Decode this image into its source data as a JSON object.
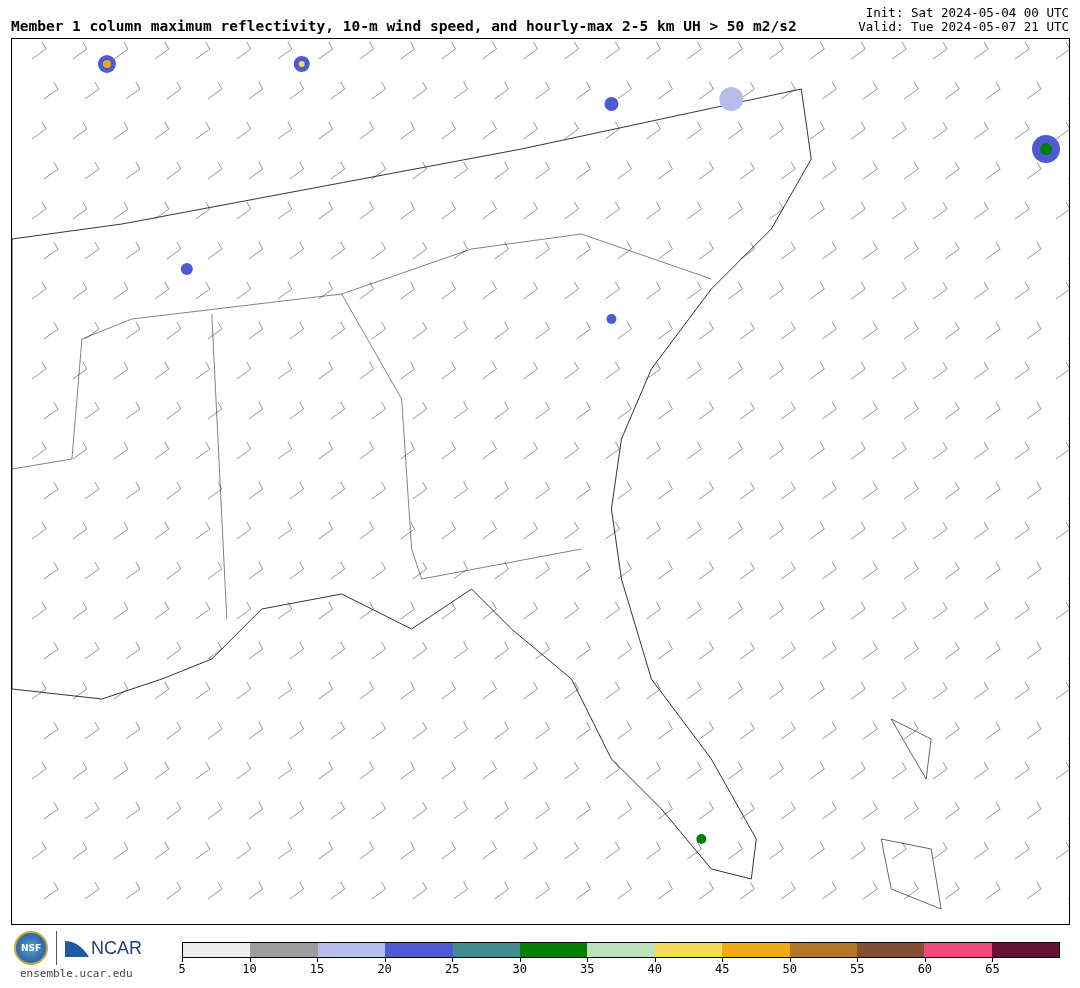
{
  "title": "Member 1 column maximum reflectivity, 10-m wind speed, and hourly-max 2-5 km UH > 50 m2/s2",
  "init": "Init: Sat 2024-05-04 00 UTC",
  "valid": "Valid: Tue 2024-05-07 21 UTC",
  "logos": {
    "nsf": "NSF",
    "ncar": "NCAR",
    "site": "ensemble.ucar.edu"
  },
  "colorbar": {
    "segments": [
      {
        "color": "#ececec"
      },
      {
        "color": "#9c9c9c"
      },
      {
        "color": "#b4bdea"
      },
      {
        "color": "#4e5ad4"
      },
      {
        "color": "#438c92"
      },
      {
        "color": "#008000"
      },
      {
        "color": "#bde0bd"
      },
      {
        "color": "#f0dc5a"
      },
      {
        "color": "#f0aa14"
      },
      {
        "color": "#b07828"
      },
      {
        "color": "#845034"
      },
      {
        "color": "#ee4a7a"
      },
      {
        "color": "#641432"
      }
    ],
    "ticks": [
      "5",
      "10",
      "15",
      "20",
      "25",
      "30",
      "35",
      "40",
      "45",
      "50",
      "55",
      "60",
      "65"
    ]
  }
}
